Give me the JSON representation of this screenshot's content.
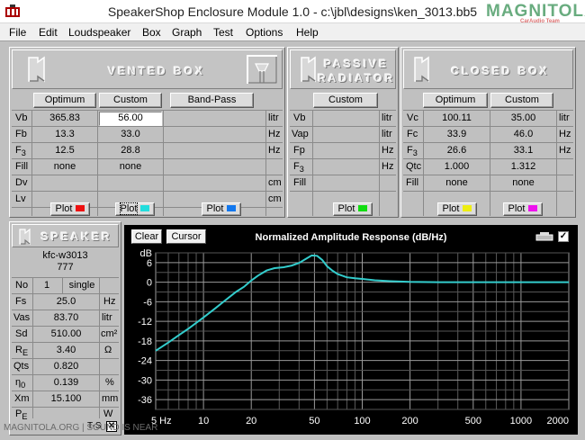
{
  "window": {
    "title": "SpeakerShop Enclosure Module 1.0 - c:\\jbl\\designs\\ken_3013.bb5",
    "logo_text": "MAGNITOLA",
    "logo_sub": "CarAudio Team"
  },
  "menu": [
    "File",
    "Edit",
    "Loudspeaker",
    "Box",
    "Graph",
    "Test",
    "Options",
    "Help"
  ],
  "vented": {
    "header": "VENTED BOX",
    "buttons": [
      "Optimum",
      "Custom",
      "Band-Pass"
    ],
    "rows": [
      {
        "label": "Vb",
        "optimum": "365.83",
        "custom": "56.00",
        "bandpass": "",
        "unit": "litr"
      },
      {
        "label": "Fb",
        "optimum": "13.3",
        "custom": "33.0",
        "bandpass": "",
        "unit": "Hz"
      },
      {
        "label": "F3",
        "optimum": "12.5",
        "custom": "28.8",
        "bandpass": "",
        "unit": "Hz"
      },
      {
        "label": "Fill",
        "optimum": "none",
        "custom": "none",
        "bandpass": "",
        "unit": ""
      },
      {
        "label": "Dv",
        "optimum": "",
        "custom": "",
        "bandpass": "",
        "unit": "cm"
      },
      {
        "label": "Lv",
        "optimum": "",
        "custom": "",
        "bandpass": "",
        "unit": "cm"
      }
    ],
    "plot_labels": [
      "Plot",
      "Plot",
      "Plot"
    ],
    "plot_colors": [
      "#ee1111",
      "#22dddd",
      "#1177ee"
    ]
  },
  "passive": {
    "header_1": "PASSIVE",
    "header_2": "RADIATOR",
    "button": "Custom",
    "rows": [
      {
        "label": "Vb",
        "value": "",
        "unit": "litr"
      },
      {
        "label": "Vap",
        "value": "",
        "unit": "litr"
      },
      {
        "label": "Fp",
        "value": "",
        "unit": "Hz"
      },
      {
        "label": "F3",
        "value": "",
        "unit": "Hz"
      },
      {
        "label": "Fill",
        "value": "",
        "unit": ""
      }
    ],
    "plot_label": "Plot",
    "plot_color": "#11dd11"
  },
  "closed": {
    "header": "CLOSED BOX",
    "buttons": [
      "Optimum",
      "Custom"
    ],
    "rows": [
      {
        "label": "Vc",
        "optimum": "100.11",
        "custom": "35.00",
        "unit": "litr"
      },
      {
        "label": "Fc",
        "optimum": "33.9",
        "custom": "46.0",
        "unit": "Hz"
      },
      {
        "label": "F3",
        "optimum": "26.6",
        "custom": "33.1",
        "unit": "Hz"
      },
      {
        "label": "Qtc",
        "optimum": "1.000",
        "custom": "1.312",
        "unit": ""
      },
      {
        "label": "Fill",
        "optimum": "none",
        "custom": "none",
        "unit": ""
      }
    ],
    "plot_labels": [
      "Plot",
      "Plot"
    ],
    "plot_colors": [
      "#eeee11",
      "#ee11ee"
    ]
  },
  "speaker": {
    "header": "SPEAKER",
    "model": "kfc-w3013",
    "model_number": "777",
    "no_label": "No",
    "no_value": "1",
    "mode": "single",
    "params": [
      {
        "label": "Fs",
        "value": "25.0",
        "unit": "Hz"
      },
      {
        "label": "Vas",
        "value": "83.70",
        "unit": "litr"
      },
      {
        "label": "Sd",
        "value": "510.00",
        "unit": "cm²"
      },
      {
        "label": "Re",
        "value": "3.40",
        "unit": "Ω"
      },
      {
        "label": "Qts",
        "value": "0.820",
        "unit": ""
      },
      {
        "label": "η0",
        "value": "0.139",
        "unit": "%"
      },
      {
        "label": "Xm",
        "value": "15.100",
        "unit": "mm"
      },
      {
        "label": "Pe",
        "value": "",
        "unit": "W"
      }
    ],
    "ts_label": "T-S"
  },
  "graph": {
    "clear_label": "Clear",
    "cursor_label": "Cursor",
    "title": "Normalized Amplitude Response (dB/Hz)"
  },
  "watermark": "MAGNITOLA.ORG | SOUND IS NEAR",
  "chart_data": {
    "type": "line",
    "title": "Normalized Amplitude Response (dB/Hz)",
    "xlabel": "Hz",
    "ylabel": "dB",
    "x_scale": "log",
    "xlim": [
      5,
      2000
    ],
    "ylim": [
      -39,
      9
    ],
    "x_ticks": [
      "5 Hz",
      "10",
      "20",
      "50",
      "100",
      "200",
      "500",
      "1000",
      "2000"
    ],
    "y_ticks": [
      "dB",
      "6",
      "0",
      "-6",
      "-12",
      "-18",
      "-24",
      "-30",
      "-36"
    ],
    "grid": true,
    "series": [
      {
        "color": "#33cccc",
        "x": [
          5,
          6,
          7,
          8,
          10,
          12,
          14,
          16,
          18,
          20,
          22,
          25,
          28,
          32,
          36,
          40,
          44,
          48,
          52,
          56,
          60,
          65,
          70,
          80,
          90,
          100,
          120,
          150,
          200,
          300,
          500,
          1000,
          2000
        ],
        "y": [
          -21,
          -18.5,
          -16.2,
          -14.3,
          -10.8,
          -7.8,
          -5.2,
          -3,
          -1.4,
          0.5,
          2,
          3.6,
          4.3,
          4.6,
          5.1,
          5.9,
          7.1,
          8.2,
          8.1,
          6.8,
          4.9,
          3.5,
          2.5,
          1.5,
          1.2,
          1,
          0.6,
          0.3,
          0.1,
          0,
          0,
          0,
          0
        ]
      }
    ]
  }
}
